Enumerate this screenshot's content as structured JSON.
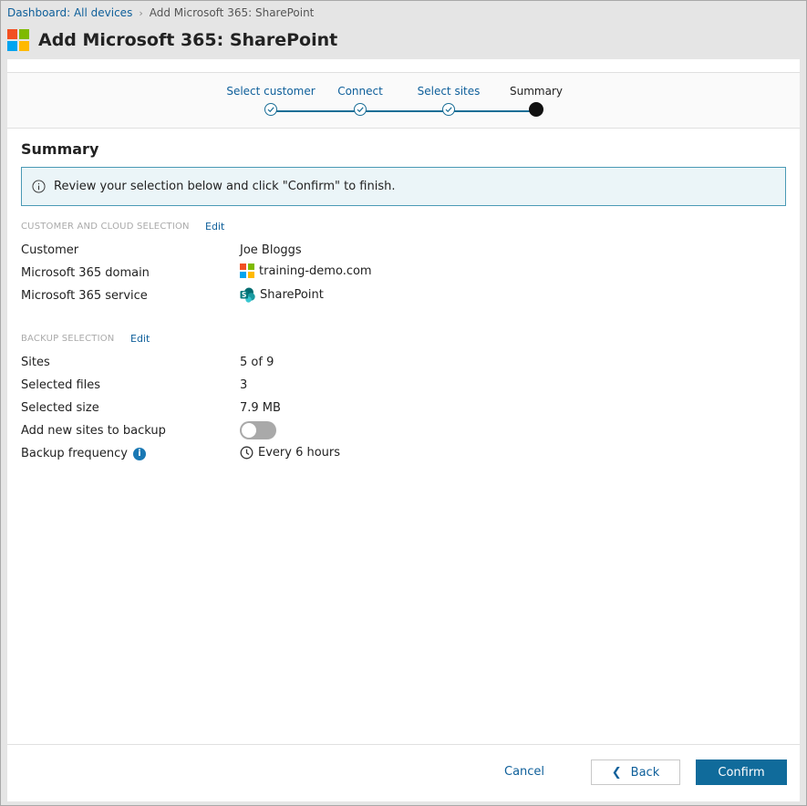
{
  "breadcrumb": {
    "parent": "Dashboard: All devices",
    "current": "Add Microsoft 365: SharePoint"
  },
  "header": {
    "title": "Add Microsoft 365: SharePoint"
  },
  "wizard": {
    "steps": [
      {
        "label": "Select customer",
        "state": "done"
      },
      {
        "label": "Connect",
        "state": "done"
      },
      {
        "label": "Select sites",
        "state": "done"
      },
      {
        "label": "Summary",
        "state": "current"
      }
    ]
  },
  "summary": {
    "title": "Summary",
    "info": "Review your selection below and click \"Confirm\" to finish."
  },
  "customer_section": {
    "heading": "CUSTOMER AND CLOUD SELECTION",
    "edit": "Edit",
    "rows": [
      {
        "label": "Customer",
        "value": "Joe Bloggs"
      },
      {
        "label": "Microsoft 365 domain",
        "value": "training-demo.com"
      },
      {
        "label": "Microsoft 365 service",
        "value": "SharePoint"
      }
    ]
  },
  "backup_section": {
    "heading": "BACKUP SELECTION",
    "edit": "Edit",
    "rows": [
      {
        "label": "Sites",
        "value": "5 of 9"
      },
      {
        "label": "Selected files",
        "value": "3"
      },
      {
        "label": "Selected size",
        "value": "7.9 MB"
      },
      {
        "label": "Add new sites to backup",
        "toggle_on": false
      },
      {
        "label": "Backup frequency",
        "value": "Every 6 hours"
      }
    ]
  },
  "footer": {
    "cancel": "Cancel",
    "back": "Back",
    "confirm": "Confirm"
  },
  "colors": {
    "accent": "#106b9b",
    "link": "#0e5f9a",
    "ms_red": "#f25022",
    "ms_green": "#7fba00",
    "ms_blue": "#00a4ef",
    "ms_yellow": "#ffb900"
  }
}
